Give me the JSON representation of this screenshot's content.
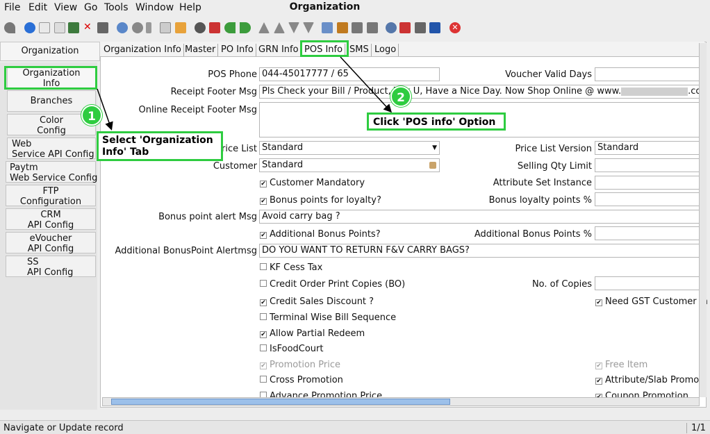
{
  "menu": [
    "File",
    "Edit",
    "View",
    "Go",
    "Tools",
    "Window",
    "Help"
  ],
  "window_title": "Organization",
  "left_tab": "Organization",
  "sidebar": [
    {
      "l1": "Organization",
      "l2": "Info"
    },
    {
      "l1": "Branches",
      "l2": ""
    },
    {
      "l1": "Color",
      "l2": "Config"
    },
    {
      "l1": "Web",
      "l2": "Service API Config"
    },
    {
      "l1": "Paytm",
      "l2": "Web Service Config"
    },
    {
      "l1": "FTP",
      "l2": "Configuration"
    },
    {
      "l1": "CRM",
      "l2": "API Config"
    },
    {
      "l1": "eVoucher",
      "l2": "API Config"
    },
    {
      "l1": "SS",
      "l2": "API Config"
    }
  ],
  "tabs": [
    "Organization Info",
    "Master",
    "PO Info",
    "GRN Info",
    "POS Info",
    "SMS",
    "Logo"
  ],
  "fields": {
    "pos_phone_label": "POS Phone",
    "pos_phone": "044-45017777  / 65",
    "voucher_valid_days_label": "Voucher Valid Days",
    "voucher_valid_days": "",
    "receipt_footer_label": "Receipt Footer Msg",
    "receipt_footer_a": "Pls Check your Bill / Product, Th",
    "receipt_footer_b": "k U, Have a Nice Day. Now Shop Online @ www.",
    "receipt_footer_c": ".com",
    "online_receipt_label": "Online Receipt Footer Msg",
    "price_list_label": "Price List",
    "price_list": "Standard",
    "price_list_version_label": "Price List Version",
    "price_list_version": "Standard",
    "customer_label": "Customer",
    "customer": "Standard",
    "selling_qty_label": "Selling Qty Limit",
    "attribute_set_label": "Attribute Set Instance",
    "bonus_loyalty_pct_label": "Bonus loyalty points %",
    "bonus_alert_label": "Bonus point alert Msg",
    "bonus_alert": "Avoid carry bag ?",
    "additional_bonus_pct_label": "Additional Bonus Points %",
    "additional_alert_label": "Additional BonusPoint Alertmsg",
    "additional_alert": "DO YOU WANT TO RETURN F&V CARRY BAGS?",
    "no_of_copies_label": "No. of Copies"
  },
  "checks": {
    "customer_mandatory": "Customer Mandatory",
    "bonus_loyalty": "Bonus points for loyalty?",
    "additional_bonus": "Additional Bonus Points?",
    "kf_cess": "KF Cess Tax",
    "credit_order_print": "Credit Order Print Copies (BO)",
    "credit_sales_discount": "Credit Sales Discount ?",
    "need_gst": "Need GST Customer In",
    "terminal_wise": "Terminal Wise Bill Sequence",
    "allow_partial": "Allow Partial Redeem",
    "is_food_court": "IsFoodCourt",
    "promotion_price": "Promotion Price",
    "free_item": "Free Item",
    "cross_promotion": "Cross Promotion",
    "attribute_slab": "Attribute/Slab Promo",
    "advance_promotion": "Advance Promotion Price",
    "coupon_promotion": "Coupon Promotion"
  },
  "callouts": {
    "step1_num": "1",
    "step1_line1": "Select 'Organization",
    "step1_line2": "Info' Tab",
    "step2_num": "2",
    "step2_text": "Click 'POS info' Option"
  },
  "status": {
    "text": "Navigate or Update record",
    "page": "1/1"
  },
  "colors": {
    "highlight": "#2ecc40",
    "badge": "#2ecc40"
  }
}
